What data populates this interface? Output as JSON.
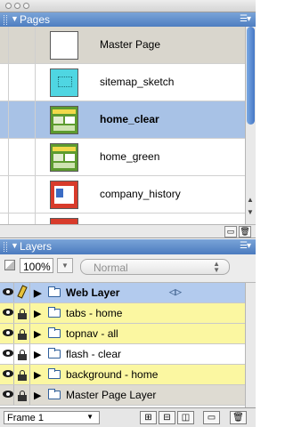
{
  "pages_panel": {
    "title": "Pages",
    "items": [
      {
        "name": "Master Page"
      },
      {
        "name": "sitemap_sketch"
      },
      {
        "name": "home_clear"
      },
      {
        "name": "home_green"
      },
      {
        "name": "company_history"
      }
    ]
  },
  "layers_panel": {
    "title": "Layers",
    "opacity": "100%",
    "blend_mode": "Normal",
    "layers": [
      {
        "name": "Web Layer"
      },
      {
        "name": "tabs - home"
      },
      {
        "name": "topnav - all"
      },
      {
        "name": "flash - clear"
      },
      {
        "name": "background - home"
      },
      {
        "name": "Master Page Layer"
      }
    ],
    "frame": "Frame 1"
  },
  "colors": {
    "panel_header": "#5f8fd0",
    "selected_row": "#a8c2e6",
    "layer_highlight": "#fbf7a1",
    "master_row": "#d9d6cd"
  }
}
